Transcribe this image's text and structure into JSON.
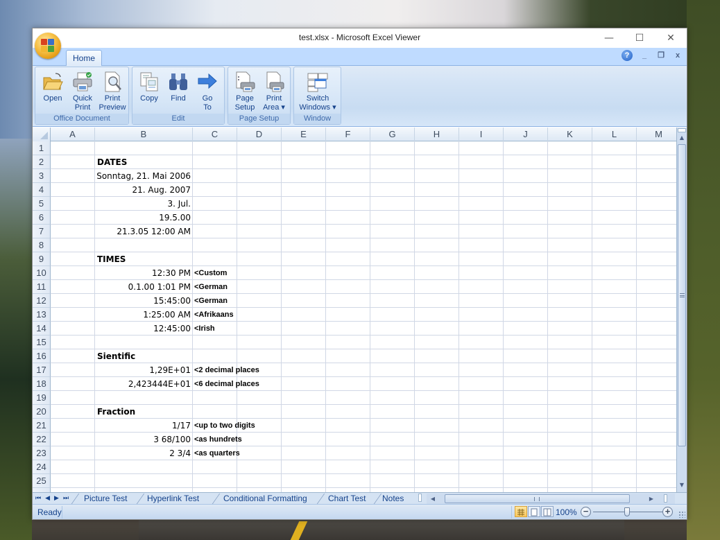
{
  "window": {
    "title": "test.xlsx - Microsoft Excel Viewer",
    "controls": {
      "minimize": "—",
      "maximize": "☐",
      "close": "✕"
    }
  },
  "ribbon": {
    "tabs": [
      {
        "label": "Home",
        "active": true
      }
    ],
    "help_label": "?",
    "mdi": {
      "minimize": "_",
      "restore": "❐",
      "close": "x"
    },
    "groups": [
      {
        "label": "Office Document",
        "buttons": [
          {
            "label_line1": "Open",
            "label_line2": "",
            "icon": "folder-open-icon"
          },
          {
            "label_line1": "Quick",
            "label_line2": "Print",
            "icon": "quick-print-icon"
          },
          {
            "label_line1": "Print",
            "label_line2": "Preview",
            "icon": "print-preview-icon"
          }
        ]
      },
      {
        "label": "Edit",
        "buttons": [
          {
            "label_line1": "Copy",
            "label_line2": "",
            "icon": "copy-icon"
          },
          {
            "label_line1": "Find",
            "label_line2": "",
            "icon": "binoculars-icon"
          },
          {
            "label_line1": "Go",
            "label_line2": "To",
            "icon": "arrow-right-icon"
          }
        ]
      },
      {
        "label": "Page Setup",
        "buttons": [
          {
            "label_line1": "Page",
            "label_line2": "Setup",
            "icon": "page-setup-icon"
          },
          {
            "label_line1": "Print",
            "label_line2": "Area ▾",
            "icon": "print-area-icon"
          }
        ]
      },
      {
        "label": "Window",
        "buttons": [
          {
            "label_line1": "Switch",
            "label_line2": "Windows ▾",
            "icon": "switch-windows-icon"
          }
        ]
      }
    ]
  },
  "grid": {
    "columns": [
      "A",
      "B",
      "C",
      "D",
      "E",
      "F",
      "G",
      "H",
      "I",
      "J",
      "K",
      "L",
      "M"
    ],
    "rows": [
      "1",
      "2",
      "3",
      "4",
      "5",
      "6",
      "7",
      "8",
      "9",
      "10",
      "11",
      "12",
      "13",
      "14",
      "15",
      "16",
      "17",
      "18",
      "19",
      "20",
      "21",
      "22",
      "23",
      "24",
      "25"
    ],
    "cells": {
      "B2": "DATES",
      "B3": "Sonntag, 21. Mai 2006",
      "B4": "21. Aug. 2007",
      "B5": "3. Jul.",
      "B6": "19.5.00",
      "B7": "21.3.05 12:00 AM",
      "B9": "TIMES",
      "B10": "12:30 PM",
      "C10": "<Custom",
      "B11": "0.1.00 1:01 PM",
      "C11": "<German",
      "B12": "15:45:00",
      "C12": "<German",
      "B13": "1:25:00 AM",
      "C13": "<Afrikaans",
      "B14": "12:45:00",
      "C14": "<Irish",
      "B16": "Sientific",
      "B17": "1,29E+01",
      "C17": "<2 decimal places",
      "B18": "2,423444E+01",
      "C18": "<6 decimal places",
      "B20": "Fraction",
      "B21": "1/17",
      "C21": "<up to two digits",
      "B22": "3 68/100",
      "C22": "<as hundrets",
      "B23": "2 3/4",
      "C23": "<as quarters"
    }
  },
  "sheet_tabs": {
    "nav": [
      "⏮",
      "◀",
      "▶",
      "⏭"
    ],
    "tabs": [
      "Picture Test",
      "Hyperlink Test",
      "Conditional Formatting",
      "Chart Test",
      "Notes"
    ]
  },
  "status": {
    "ready": "Ready",
    "zoom": "100%",
    "zoom_level_percent": 100,
    "zoom_out": "−",
    "zoom_in": "+"
  }
}
